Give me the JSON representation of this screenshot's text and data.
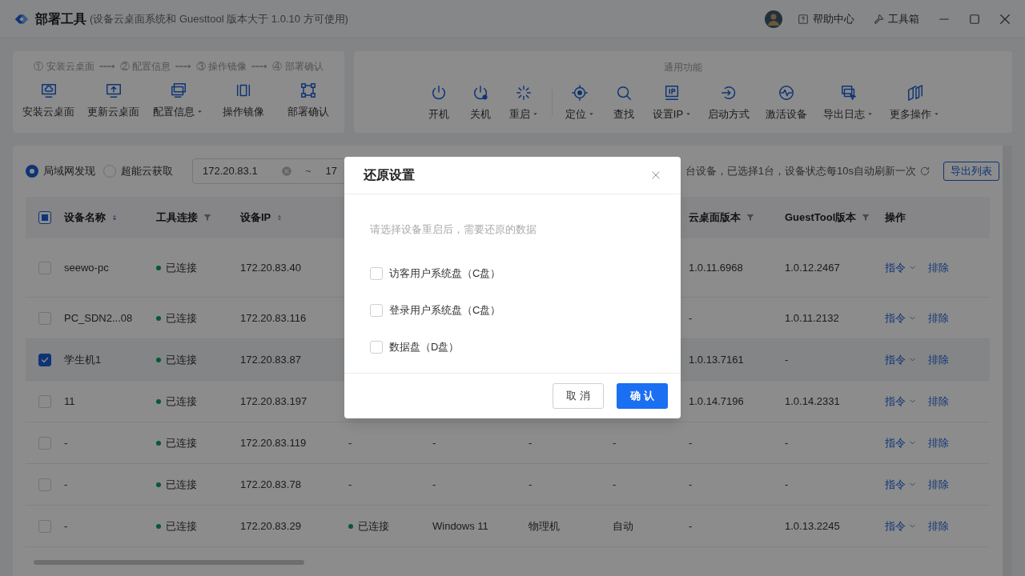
{
  "window": {
    "title": "部署工具",
    "subtitle": "(设备云桌面系统和 Guesttool 版本大于 1.0.10 方可使用)",
    "links": [
      {
        "label": "帮助中心"
      },
      {
        "label": "工具箱"
      }
    ]
  },
  "deploy_panel": {
    "steps": [
      "① 安装云桌面",
      "② 配置信息",
      "③ 操作镜像",
      "④ 部署确认"
    ],
    "buttons": [
      {
        "label": "安装云桌面",
        "dropdown": false
      },
      {
        "label": "更新云桌面",
        "dropdown": false
      },
      {
        "label": "配置信息",
        "dropdown": true
      },
      {
        "label": "操作镜像",
        "dropdown": false
      },
      {
        "label": "部署确认",
        "dropdown": false
      }
    ]
  },
  "common_panel": {
    "title": "通用功能",
    "groups": [
      [
        {
          "label": "开机",
          "dropdown": false
        },
        {
          "label": "关机",
          "dropdown": false
        },
        {
          "label": "重启",
          "dropdown": true
        }
      ],
      [
        {
          "label": "定位",
          "dropdown": true
        },
        {
          "label": "查找",
          "dropdown": false
        },
        {
          "label": "设置IP",
          "dropdown": true
        },
        {
          "label": "启动方式",
          "dropdown": false
        },
        {
          "label": "激活设备",
          "dropdown": false
        },
        {
          "label": "导出日志",
          "dropdown": true
        },
        {
          "label": "更多操作",
          "dropdown": true
        }
      ]
    ]
  },
  "discovery": {
    "options": [
      {
        "label": "局域网发现",
        "selected": true
      },
      {
        "label": "超能云获取",
        "selected": false
      }
    ],
    "ip_from": "172.20.83.1",
    "range_separator": "~",
    "ip_to": "17",
    "summary": "台设备，已选择1台，设备状态每10s自动刷新一次",
    "export_button": "导出列表"
  },
  "table": {
    "select_all_indeterminate": true,
    "columns": [
      {
        "label": "设备名称",
        "sorted_descending": true
      },
      {
        "label": "工具连接"
      },
      {
        "label": "设备IP",
        "sorted_descending": false
      },
      {
        "label": "云桌面版本"
      },
      {
        "label": "GuestTool版本"
      },
      {
        "label": "操作"
      }
    ],
    "rows": [
      {
        "checked": false,
        "name": "seewo-pc",
        "tool": "已连接",
        "ip": "172.20.83.40",
        "cloud": "1.0.11.6968",
        "guest": "1.0.12.2467",
        "command": "指令",
        "exclude": "排除"
      },
      {
        "checked": false,
        "name": "PC_SDN2...08",
        "tool": "已连接",
        "ip": "172.20.83.116",
        "cloud": "-",
        "guest": "1.0.11.2132",
        "command": "指令",
        "exclude": "排除"
      },
      {
        "checked": true,
        "name": "学生机1",
        "tool": "已连接",
        "ip": "172.20.83.87",
        "cloud": "1.0.13.7161",
        "guest": "-",
        "command": "指令",
        "exclude": "排除"
      },
      {
        "checked": false,
        "name": "11",
        "tool": "已连接",
        "ip": "172.20.83.197",
        "cloud": "1.0.14.7196",
        "guest": "1.0.14.2331",
        "command": "指令",
        "exclude": "排除"
      },
      {
        "checked": false,
        "name": "-",
        "tool": "已连接",
        "ip": "172.20.83.119",
        "column_4": "-",
        "column_4_status": false,
        "column_5": "-",
        "column_6": "-",
        "column_7": "-",
        "cloud": "-",
        "guest": "-",
        "command": "指令",
        "exclude": "排除"
      },
      {
        "checked": false,
        "name": "-",
        "tool": "已连接",
        "ip": "172.20.83.78",
        "column_4": "-",
        "column_4_status": false,
        "column_5": "-",
        "column_6": "-",
        "column_7": "-",
        "cloud": "-",
        "guest": "-",
        "command": "指令",
        "exclude": "排除"
      },
      {
        "checked": false,
        "name": "-",
        "tool": "已连接",
        "ip": "172.20.83.29",
        "column_4": "已连接",
        "column_4_status": true,
        "column_5": "Windows 11",
        "column_6": "物理机",
        "column_7": "自动",
        "cloud": "-",
        "guest": "1.0.13.2245",
        "command": "指令",
        "exclude": "排除"
      }
    ]
  },
  "dialog": {
    "title": "还原设置",
    "hint": "请选择设备重启后，需要还原的数据",
    "options": [
      {
        "label": "访客用户系统盘（C盘）",
        "checked": false
      },
      {
        "label": "登录用户系统盘（C盘）",
        "checked": false
      },
      {
        "label": "数据盘（D盘）",
        "checked": false
      }
    ],
    "cancel": "取 消",
    "confirm": "确 认"
  }
}
